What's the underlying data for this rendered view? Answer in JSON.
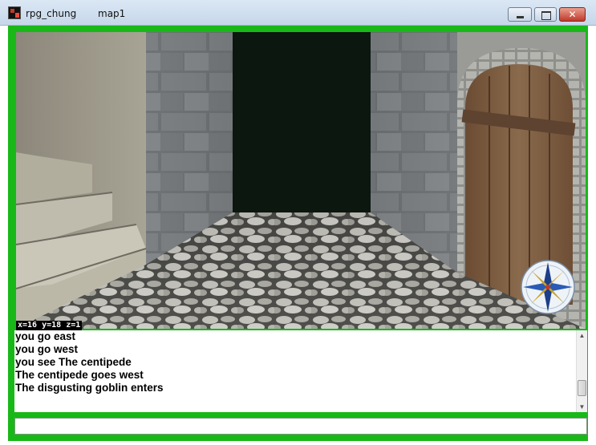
{
  "window": {
    "app_title": "rpg_chung",
    "map_title": "map1",
    "close_glyph": "✕"
  },
  "hud": {
    "coordinates": "x=16 y=18 z=1"
  },
  "log": {
    "lines": [
      "you go east",
      "you go west",
      "you see The centipede",
      "The centipede goes west",
      "The disgusting goblin enters"
    ]
  },
  "command": {
    "value": ""
  },
  "colors": {
    "frame": "#18b818",
    "door": "#7a5a3e",
    "dark_corridor": "#0b170f"
  },
  "icons": {
    "compass": "compass-rose-icon",
    "app": "app-icon"
  }
}
